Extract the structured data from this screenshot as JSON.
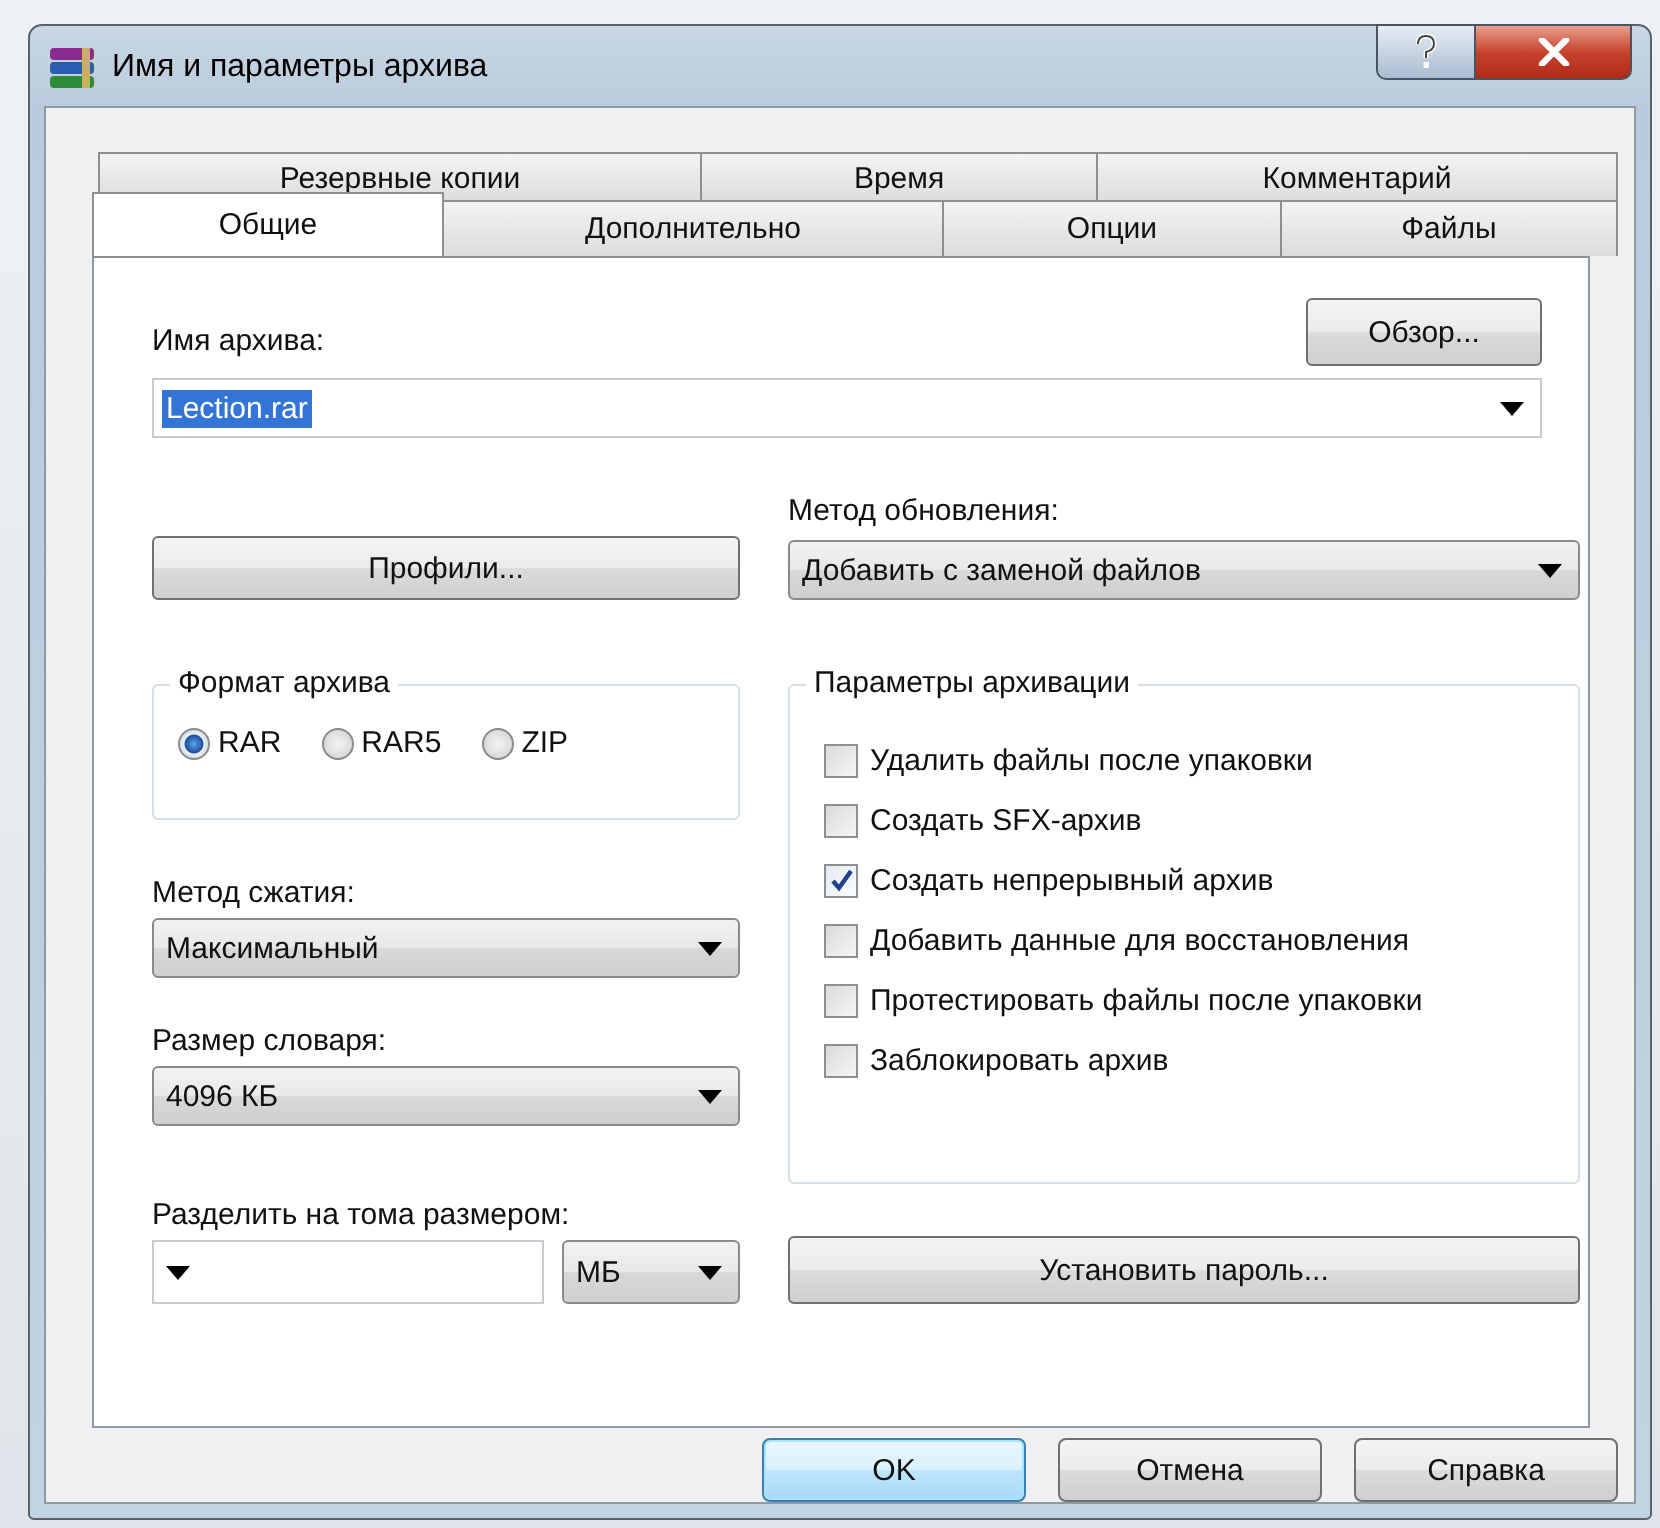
{
  "window": {
    "title": "Имя и параметры архива"
  },
  "tab_rows": [
    {
      "tabs": [
        {
          "label": "Резервные копии",
          "selected": false
        },
        {
          "label": "Время",
          "selected": false
        },
        {
          "label": "Комментарий",
          "selected": false
        }
      ]
    },
    {
      "tabs": [
        {
          "label": "Общие",
          "selected": true
        },
        {
          "label": "Дополнительно",
          "selected": false
        },
        {
          "label": "Опции",
          "selected": false
        },
        {
          "label": "Файлы",
          "selected": false
        }
      ]
    }
  ],
  "archive_name": {
    "label": "Имя архива:",
    "value": "Lection.rar",
    "text_selected": true,
    "browse_button": "Обзор..."
  },
  "profiles_button": "Профили...",
  "update_method": {
    "label": "Метод обновления:",
    "value": "Добавить с заменой файлов"
  },
  "archive_format": {
    "title": "Формат архива",
    "options": [
      {
        "label": "RAR",
        "selected": true
      },
      {
        "label": "RAR5",
        "selected": false
      },
      {
        "label": "ZIP",
        "selected": false
      }
    ]
  },
  "compression_method": {
    "label": "Метод сжатия:",
    "value": "Максимальный"
  },
  "dictionary_size": {
    "label": "Размер словаря:",
    "value": "4096 КБ"
  },
  "split_volumes": {
    "label": "Разделить на тома размером:",
    "unit": "МБ"
  },
  "archiving_options": {
    "title": "Параметры архивации",
    "items": [
      {
        "label": "Удалить файлы после упаковки",
        "checked": false
      },
      {
        "label": "Создать SFX-архив",
        "checked": false
      },
      {
        "label": "Создать непрерывный архив",
        "checked": true
      },
      {
        "label": "Добавить данные для восстановления",
        "checked": false
      },
      {
        "label": "Протестировать файлы после упаковки",
        "checked": false
      },
      {
        "label": "Заблокировать архив",
        "checked": false
      }
    ]
  },
  "password_button": "Установить пароль...",
  "buttons": [
    {
      "label": "OK",
      "default": true
    },
    {
      "label": "Отмена",
      "default": false
    },
    {
      "label": "Справка",
      "default": false
    }
  ]
}
